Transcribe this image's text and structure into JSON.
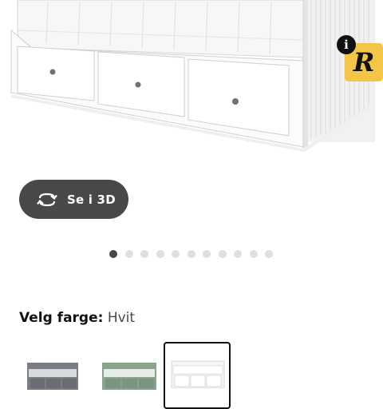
{
  "hero": {
    "badge_icon": "info-icon",
    "badge_info_glyph": "i",
    "badge_tile_glyph": "R",
    "badge_tile_color": "#f4c648"
  },
  "view_3d_button": {
    "label": "Se i 3D",
    "icon": "rotate-3d-icon"
  },
  "carousel": {
    "total": 11,
    "active_index": 0
  },
  "color_selector": {
    "label": "Velg farge:",
    "value": "Hvit",
    "options": [
      {
        "name": "grey",
        "color": "#7b7d84",
        "selected": false
      },
      {
        "name": "green",
        "color": "#8aa38e",
        "selected": false
      },
      {
        "name": "white",
        "color": "#f3f3f3",
        "selected": true
      }
    ]
  }
}
